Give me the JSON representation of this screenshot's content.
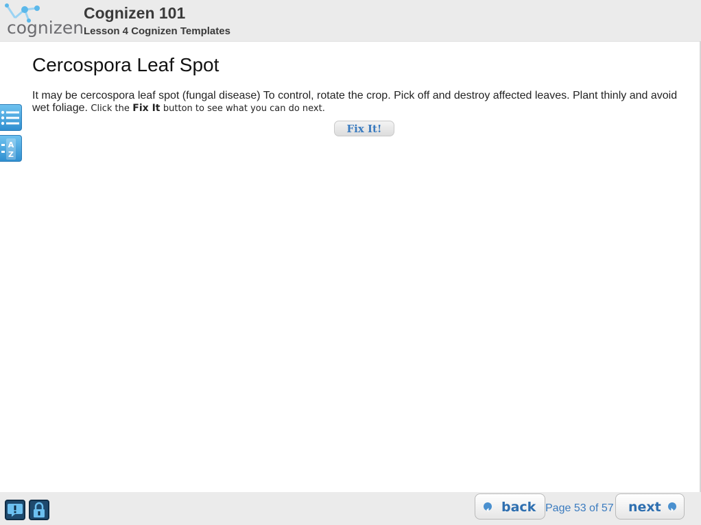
{
  "header": {
    "logo_text": "cognizen",
    "course_title": "Cognizen 101",
    "lesson_title": "Lesson 4 Cognizen Templates"
  },
  "side_tools": [
    {
      "icon": "outline-list-icon"
    },
    {
      "icon": "glossary-az-icon"
    }
  ],
  "content": {
    "page_title": "Cercospora Leaf Spot",
    "body_main": "It may be cercospora leaf spot (fungal disease) To control, rotate the crop. Pick off and destroy affected leaves. Plant thinly and avoid wet foliage.",
    "body_click": "Click the",
    "body_fix_strong": "Fix It",
    "body_suffix": "button to see what you can do next.",
    "fix_button_label": "Fix It!"
  },
  "footer": {
    "help_icon": "help-comment-icon",
    "lock_icon": "lock-icon",
    "back_label": "back",
    "next_label": "next",
    "page_indicator": "Page 53 of 57"
  },
  "colors": {
    "header_bg": "#ebebeb",
    "accent_blue": "#3a7bbf",
    "tool_blue": "#2f8fd0"
  }
}
